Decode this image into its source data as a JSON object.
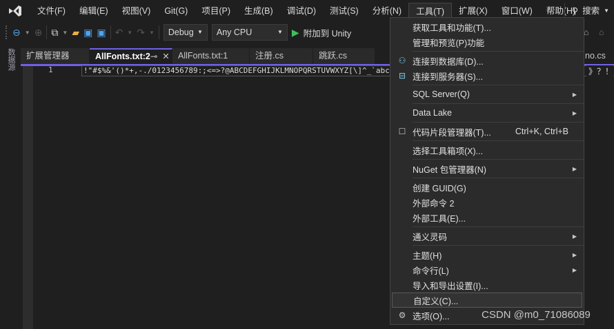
{
  "menubar": {
    "items": [
      "文件(F)",
      "编辑(E)",
      "视图(V)",
      "Git(G)",
      "项目(P)",
      "生成(B)",
      "调试(D)",
      "测试(S)",
      "分析(N)",
      "工具(T)",
      "扩展(X)",
      "窗口(W)",
      "帮助(H)"
    ],
    "search": "搜索"
  },
  "toolbar": {
    "config": "Debug",
    "platform": "Any CPU",
    "run": "附加到 Unity"
  },
  "leftbar": {
    "label": "数据源"
  },
  "tabs": [
    "扩展管理器",
    "AllFonts.txt:2",
    "AllFonts.txt:1",
    "注册.cs",
    "跳跃.cs"
  ],
  "hidden_tab_tail": "no.cs",
  "editor": {
    "line_number": "1",
    "text": "!\"#$%&'()*+,-./0123456789:;<=>?@ABCDEFGHIJKLMNOPQRSTUVWXYZ[\\]^_`abcdef",
    "text_end": "》？！"
  },
  "tools_menu": [
    {
      "label": "获取工具和功能(T)..."
    },
    {
      "label": "管理和预览(P)功能"
    },
    {
      "sep": true
    },
    {
      "label": "连接到数据库(D)...",
      "icon": "plug-database-icon"
    },
    {
      "label": "连接到服务器(S)...",
      "icon": "plug-server-icon"
    },
    {
      "sep": true
    },
    {
      "label": "SQL Server(Q)",
      "submenu": true
    },
    {
      "sep": true
    },
    {
      "label": "Data Lake",
      "submenu": true
    },
    {
      "sep": true
    },
    {
      "label": "代码片段管理器(T)...",
      "shortcut": "Ctrl+K, Ctrl+B",
      "icon": "snippet-icon"
    },
    {
      "sep": true
    },
    {
      "label": "选择工具箱项(X)..."
    },
    {
      "sep": true
    },
    {
      "label": "NuGet 包管理器(N)",
      "submenu": true
    },
    {
      "sep": true
    },
    {
      "label": "创建 GUID(G)"
    },
    {
      "label": "外部命令 2"
    },
    {
      "label": "外部工具(E)..."
    },
    {
      "sep": true
    },
    {
      "label": "通义灵码",
      "submenu": true
    },
    {
      "sep": true
    },
    {
      "label": "主题(H)",
      "submenu": true
    },
    {
      "label": "命令行(L)",
      "submenu": true
    },
    {
      "label": "导入和导出设置(I)..."
    },
    {
      "label": "自定义(C)...",
      "highlighted": true
    },
    {
      "label": "选项(O)...",
      "icon": "gear-icon"
    }
  ],
  "watermark": "CSDN @m0_71086089"
}
